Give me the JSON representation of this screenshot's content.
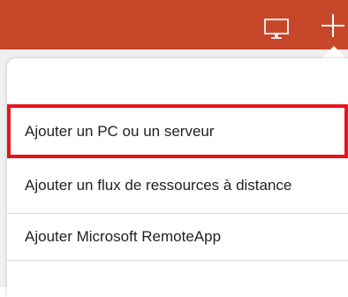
{
  "toolbar": {
    "desktop_icon": "desktop-monitor-icon",
    "add_icon": "plus-icon",
    "background_color": "#c6472a"
  },
  "menu": {
    "items": [
      {
        "label": "Ajouter un PC ou un serveur",
        "highlighted": true
      },
      {
        "label": "Ajouter un flux de ressources à distance",
        "highlighted": false
      },
      {
        "label": "Ajouter Microsoft RemoteApp",
        "highlighted": false
      }
    ],
    "highlight_color": "#e8141c"
  }
}
